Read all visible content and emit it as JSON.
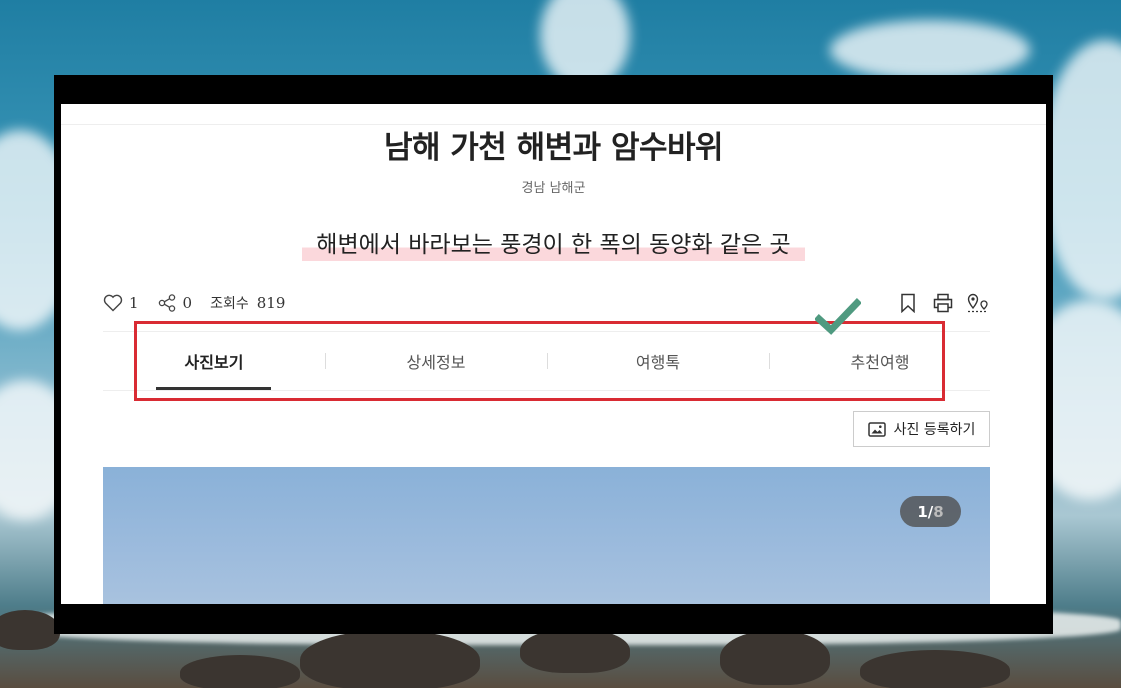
{
  "page": {
    "title": "남해 가천 해변과 암수바위",
    "region": "경남 남해군",
    "subtitle": "해변에서 바라보는 풍경이 한 폭의 동양화 같은 곳"
  },
  "stats": {
    "likes": "1",
    "shares": "0",
    "views_label": "조회수",
    "views": "819"
  },
  "tools": [
    {
      "icon": "bookmark-icon"
    },
    {
      "icon": "print-icon"
    },
    {
      "icon": "map-route-icon"
    }
  ],
  "tabs": [
    {
      "label": "사진보기",
      "active": true
    },
    {
      "label": "상세정보",
      "active": false
    },
    {
      "label": "여행톡",
      "active": false
    },
    {
      "label": "추천여행",
      "active": false
    }
  ],
  "register_button": {
    "label": "사진 등록하기",
    "icon": "image-icon"
  },
  "gallery": {
    "current": "1",
    "separator": "/",
    "total": "8"
  },
  "annotation": {
    "highlight_color": "#d92b33",
    "check_color": "#4f9a80"
  }
}
